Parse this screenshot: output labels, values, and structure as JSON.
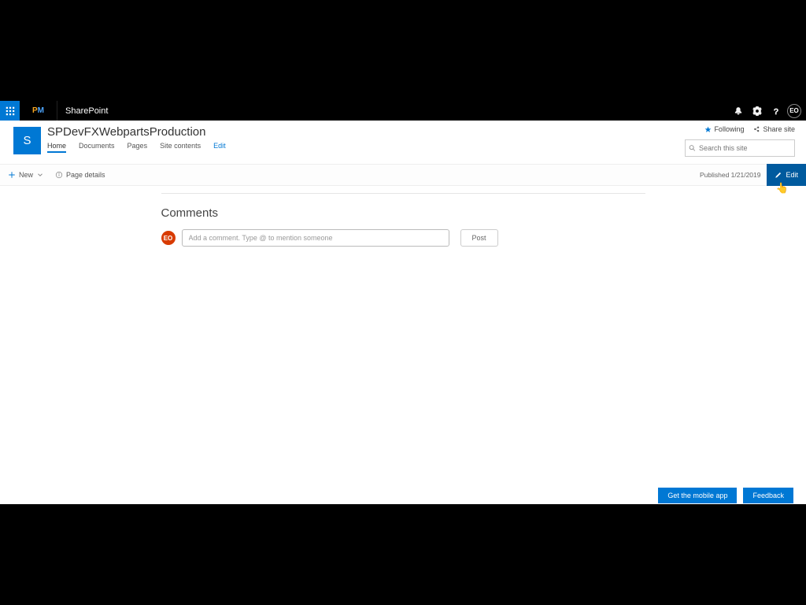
{
  "suite": {
    "app_name": "SharePoint",
    "brand_p": "P",
    "brand_m": "M",
    "avatar_initials": "EO"
  },
  "site": {
    "logo_letter": "S",
    "title": "SPDevFXWebpartsProduction",
    "nav": {
      "home": "Home",
      "documents": "Documents",
      "pages": "Pages",
      "site_contents": "Site contents",
      "edit": "Edit"
    },
    "actions": {
      "following": "Following",
      "share": "Share site"
    },
    "search": {
      "placeholder": "Search this site"
    }
  },
  "command_bar": {
    "new": "New",
    "page_details": "Page details",
    "published": "Published 1/21/2019",
    "edit": "Edit"
  },
  "comments": {
    "heading": "Comments",
    "avatar_initials": "EO",
    "placeholder": "Add a comment. Type @ to mention someone",
    "post": "Post"
  },
  "footer": {
    "mobile": "Get the mobile app",
    "feedback": "Feedback"
  }
}
